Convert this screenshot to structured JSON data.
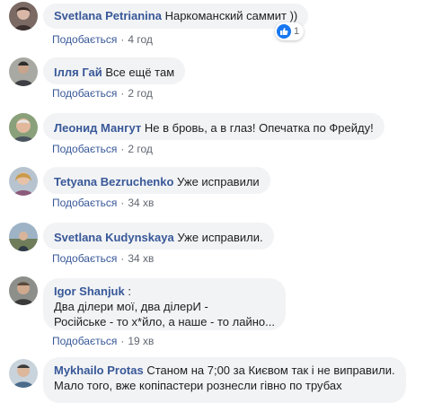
{
  "comments": [
    {
      "author": "Svetlana Petrianina",
      "text": "Наркоманский саммит ))",
      "like_label": "Подобається",
      "time": "4 год",
      "reaction_count": "1"
    },
    {
      "author": "Ілля Гай",
      "text": "Все ещё там",
      "like_label": "Подобається",
      "time": "2 год"
    },
    {
      "author": "Леонид Мангут",
      "text": "Не в бровь, а в глаз! Опечатка по Фрейду!",
      "like_label": "Подобається",
      "time": "2 год"
    },
    {
      "author": "Tetyana Bezruchenko",
      "text": "Уже исправили",
      "like_label": "Подобається",
      "time": "34 хв"
    },
    {
      "author": "Svetlana Kudynskaya",
      "text": "Уже исправили.",
      "like_label": "Подобається",
      "time": "34 хв"
    },
    {
      "author": "Igor Shanjuk",
      "text_suffix": ":",
      "lines": [
        "Два ділери мої, два ділерИ -",
        "Російське - то х*йло, а наше - то лайно..."
      ],
      "like_label": "Подобається",
      "time": "19 хв"
    },
    {
      "author": "Mykhailo Protas",
      "text": "Станом на 7;00 за Києвом так і не виправили.",
      "lines": [
        "Мало того, вже копіпастери рознесли гівно по трубах"
      ]
    }
  ],
  "colors": {
    "link": "#385898",
    "bubble": "#f2f3f5",
    "meta": "#616770",
    "like_blue": "#1877f2"
  }
}
